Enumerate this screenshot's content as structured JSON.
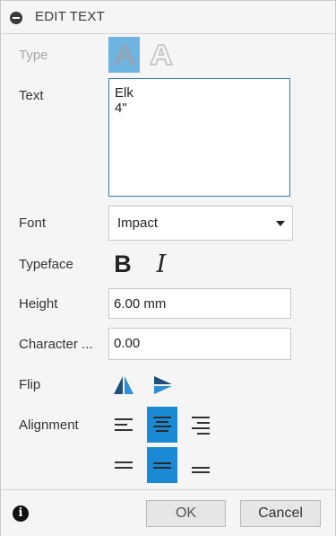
{
  "header": {
    "title": "EDIT TEXT"
  },
  "labels": {
    "type": "Type",
    "text": "Text",
    "font": "Font",
    "typeface": "Typeface",
    "height": "Height",
    "character_spacing": "Character ...",
    "flip": "Flip",
    "alignment": "Alignment"
  },
  "text_value": {
    "line1": "Elk",
    "line2": "4\""
  },
  "font": {
    "selected": "Impact"
  },
  "height": {
    "value": "6.00 mm"
  },
  "character_spacing": {
    "value": "0.00"
  },
  "typeface": {
    "bold": "B",
    "italic": "I"
  },
  "type_options": [
    "solid-text",
    "outline-text"
  ],
  "type_selected": "solid-text",
  "alignment": {
    "horizontal_selected": "center",
    "vertical_selected": "middle"
  },
  "footer": {
    "ok_label": "OK",
    "cancel_label": "Cancel"
  },
  "colors": {
    "accent": "#1a8ad4",
    "field_border_focus": "#2e7cb8"
  }
}
